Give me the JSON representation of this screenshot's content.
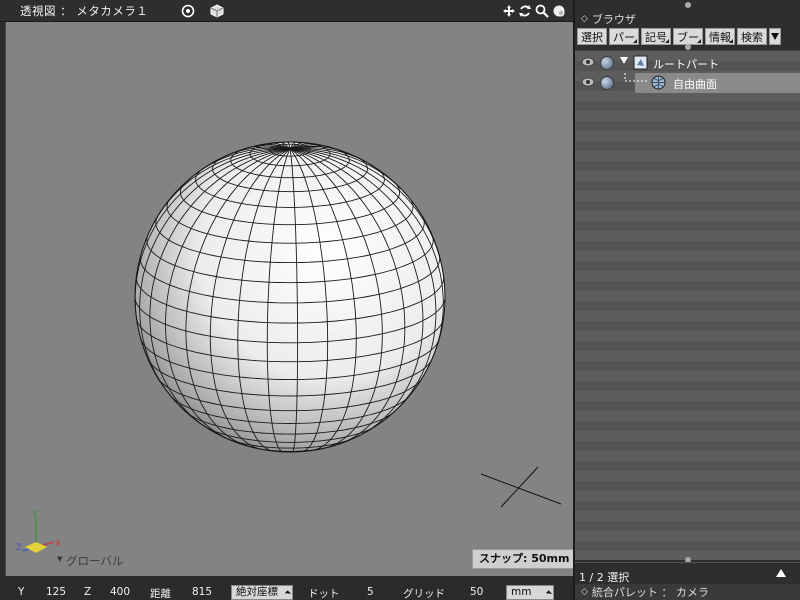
{
  "viewport": {
    "title": "透視図 ： メタカメラ１",
    "axis_label": "グローバル",
    "snap_label": "スナップ: 50mm",
    "axes": {
      "y": "Y",
      "x": "X",
      "z": "Z"
    },
    "icons": [
      "target-icon",
      "cube-icon",
      "move-icon",
      "rotate-icon",
      "zoom-icon",
      "settings-icon"
    ]
  },
  "statusbar": {
    "y_label": "Y",
    "y_value": "125",
    "z_label": "Z",
    "z_value": "400",
    "distance_label": "距離",
    "distance_value": "815",
    "coord_mode": "絶対座標",
    "dot_label": "ドット",
    "dot_value": "5",
    "grid_label": "グリッド",
    "grid_value": "50",
    "unit": "mm"
  },
  "browser": {
    "title": "ブラウザ",
    "tabs": [
      {
        "label": "選択"
      },
      {
        "label": "パー"
      },
      {
        "label": "記号"
      },
      {
        "label": "ブー"
      },
      {
        "label": "情報"
      },
      {
        "label": "検索"
      }
    ],
    "tree": [
      {
        "label": "ルートパート",
        "icon": "part-icon",
        "selected": false
      },
      {
        "label": "自由曲面",
        "icon": "surface-icon",
        "selected": true
      }
    ],
    "selection_count": "1 / 2 選択"
  },
  "palette": {
    "title": "統合パレット ： カメラ"
  }
}
